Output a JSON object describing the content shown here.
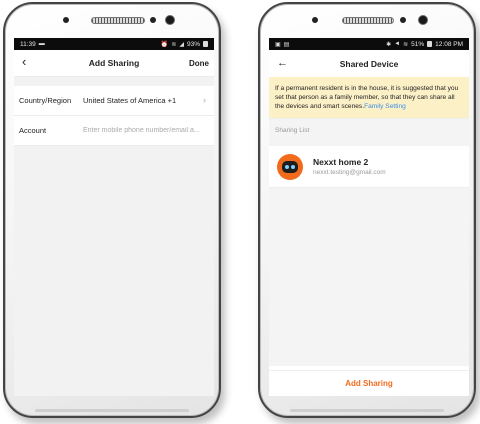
{
  "left_phone": {
    "status": {
      "time": "11:39",
      "battery": "93%"
    },
    "header": {
      "back_icon": "chevron-left-icon",
      "title": "Add Sharing",
      "action": "Done"
    },
    "form": {
      "country_label": "Country/Region",
      "country_value": "United States of America +1",
      "account_label": "Account",
      "account_placeholder": "Enter mobile phone number/email a..."
    }
  },
  "right_phone": {
    "status": {
      "signal_info": "51%",
      "time": "12:08 PM"
    },
    "header": {
      "back_icon": "arrow-left-icon",
      "title": "Shared Device"
    },
    "notice": {
      "text": "If a permanent resident is in the house, it is suggested that you set that person as a family member, so that they can share all the devices and smart scenes.",
      "link": "Family Setting"
    },
    "sharing_list": {
      "label": "Sharing List",
      "members": [
        {
          "name": "Nexxt home 2",
          "email": "nexxt.testing@gmail.com"
        }
      ]
    },
    "bottom_button": "Add Sharing"
  },
  "colors": {
    "accent": "#f26b1d",
    "link": "#3b8ee6",
    "notice_bg": "#fcf0c7"
  }
}
